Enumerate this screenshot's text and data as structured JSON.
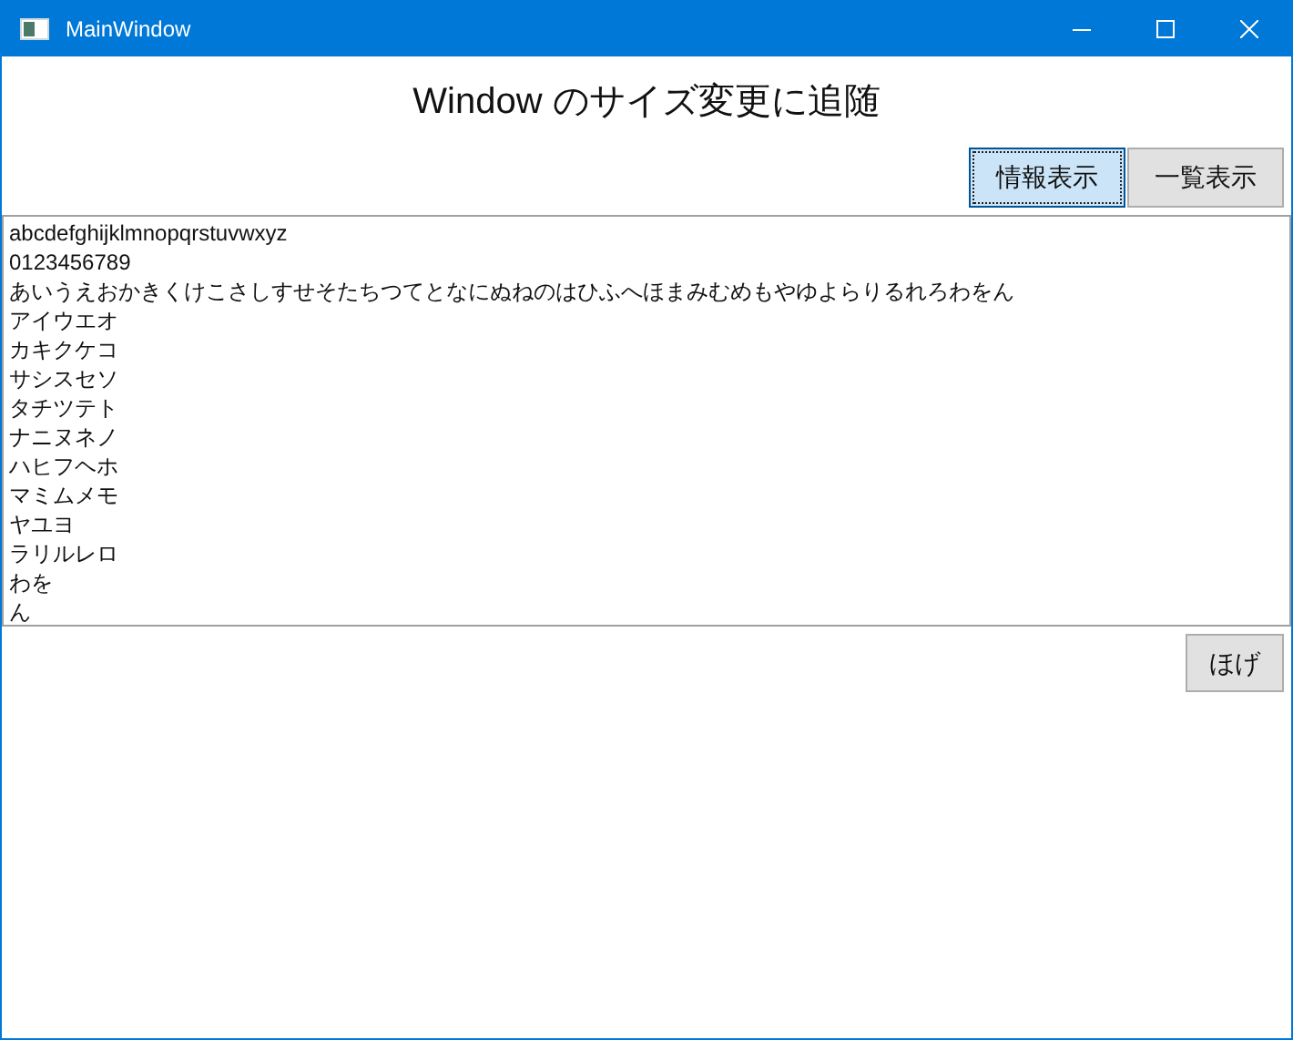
{
  "window": {
    "title": "MainWindow"
  },
  "heading": "Window のサイズ変更に追随",
  "view_buttons": [
    {
      "label": "情報表示",
      "focused": true
    },
    {
      "label": "一覧表示",
      "focused": false
    }
  ],
  "text_box": {
    "lines": [
      "abcdefghijklmnopqrstuvwxyz",
      "0123456789",
      "あいうえおかきくけこさしすせそたちつてとなにぬねのはひふへほまみむめもやゆよらりるれろわをん",
      "アイウエオ",
      "カキクケコ",
      "サシスセソ",
      "タチツテト",
      "ナニヌネノ",
      "ハヒフヘホ",
      "マミムメモ",
      "ヤユヨ",
      "ラリルレロ",
      "わを",
      "ん"
    ]
  },
  "action_button": {
    "label": "ほげ"
  }
}
